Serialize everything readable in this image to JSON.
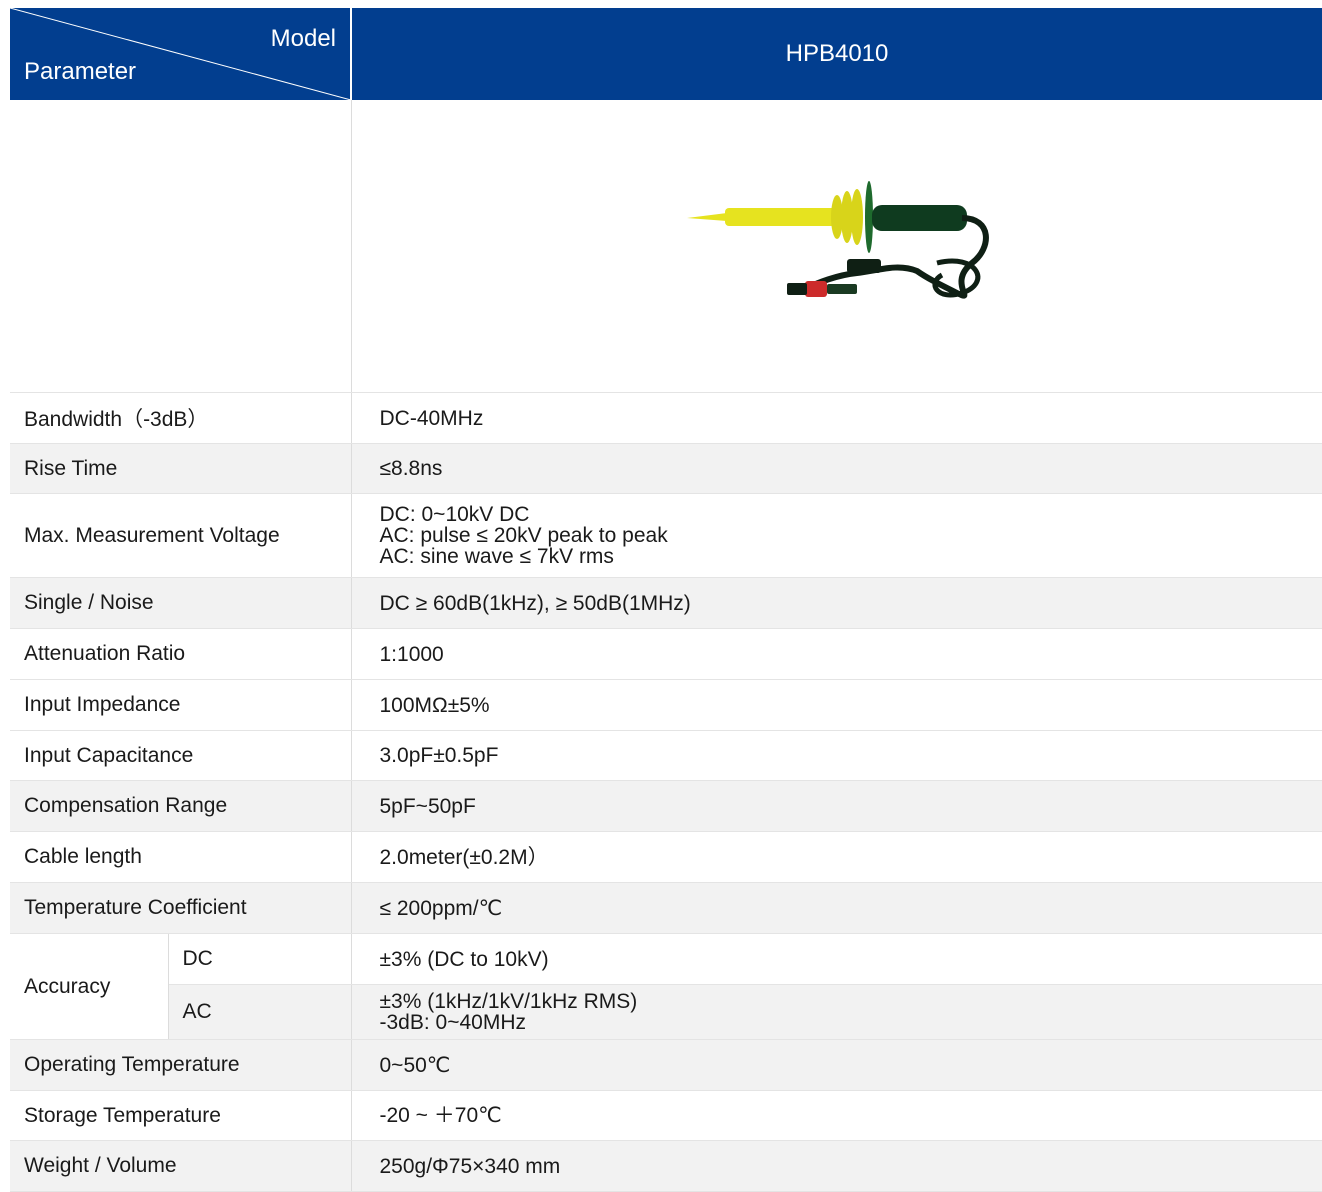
{
  "header": {
    "corner_top": "Model",
    "corner_bottom": "Parameter",
    "model": "HPB4010"
  },
  "product_image": {
    "icon": "high-voltage-probe-image",
    "probe_tip_color": "#e6e31f",
    "probe_body_color": "#0f3b1f",
    "connector_color": "#cc2b2b"
  },
  "rows": [
    {
      "label": "Bandwidth（-3dB）",
      "value": [
        "DC-40MHz"
      ]
    },
    {
      "label": "Rise Time",
      "value": [
        "≤8.8ns"
      ]
    },
    {
      "label": "Max. Measurement Voltage",
      "value": [
        "DC: 0~10kV DC",
        "AC: pulse ≤  20kV peak to peak",
        "AC: sine wave ≤ 7kV rms"
      ]
    },
    {
      "label": "Single / Noise",
      "value": [
        "DC ≥ 60dB(1kHz), ≥ 50dB(1MHz)"
      ]
    },
    {
      "label": "Attenuation Ratio",
      "value": [
        "1:1000"
      ]
    },
    {
      "label": "Input Impedance",
      "value": [
        "100MΩ±5%"
      ]
    },
    {
      "label": "Input Capacitance",
      "value": [
        "3.0pF±0.5pF"
      ]
    },
    {
      "label": "Compensation Range",
      "value": [
        "5pF~50pF"
      ]
    },
    {
      "label": "Cable length",
      "value": [
        "2.0meter(±0.2M）"
      ]
    },
    {
      "label": "Temperature Coefficient",
      "value": [
        "≤ 200ppm/℃"
      ]
    }
  ],
  "accuracy": {
    "label": "Accuracy",
    "dc_label": "DC",
    "dc_value": [
      "±3% (DC to 10kV)"
    ],
    "ac_label": "AC",
    "ac_value": [
      "±3% (1kHz/1kV/1kHz RMS)",
      "-3dB: 0~40MHz"
    ]
  },
  "rows_after": [
    {
      "label": "Operating Temperature",
      "value": [
        "0~50℃"
      ]
    },
    {
      "label": "Storage Temperature",
      "value": [
        "-20 ~  ＋70℃"
      ]
    },
    {
      "label": "Weight / Volume",
      "value": [
        "250g/Φ75×340 mm"
      ]
    }
  ]
}
